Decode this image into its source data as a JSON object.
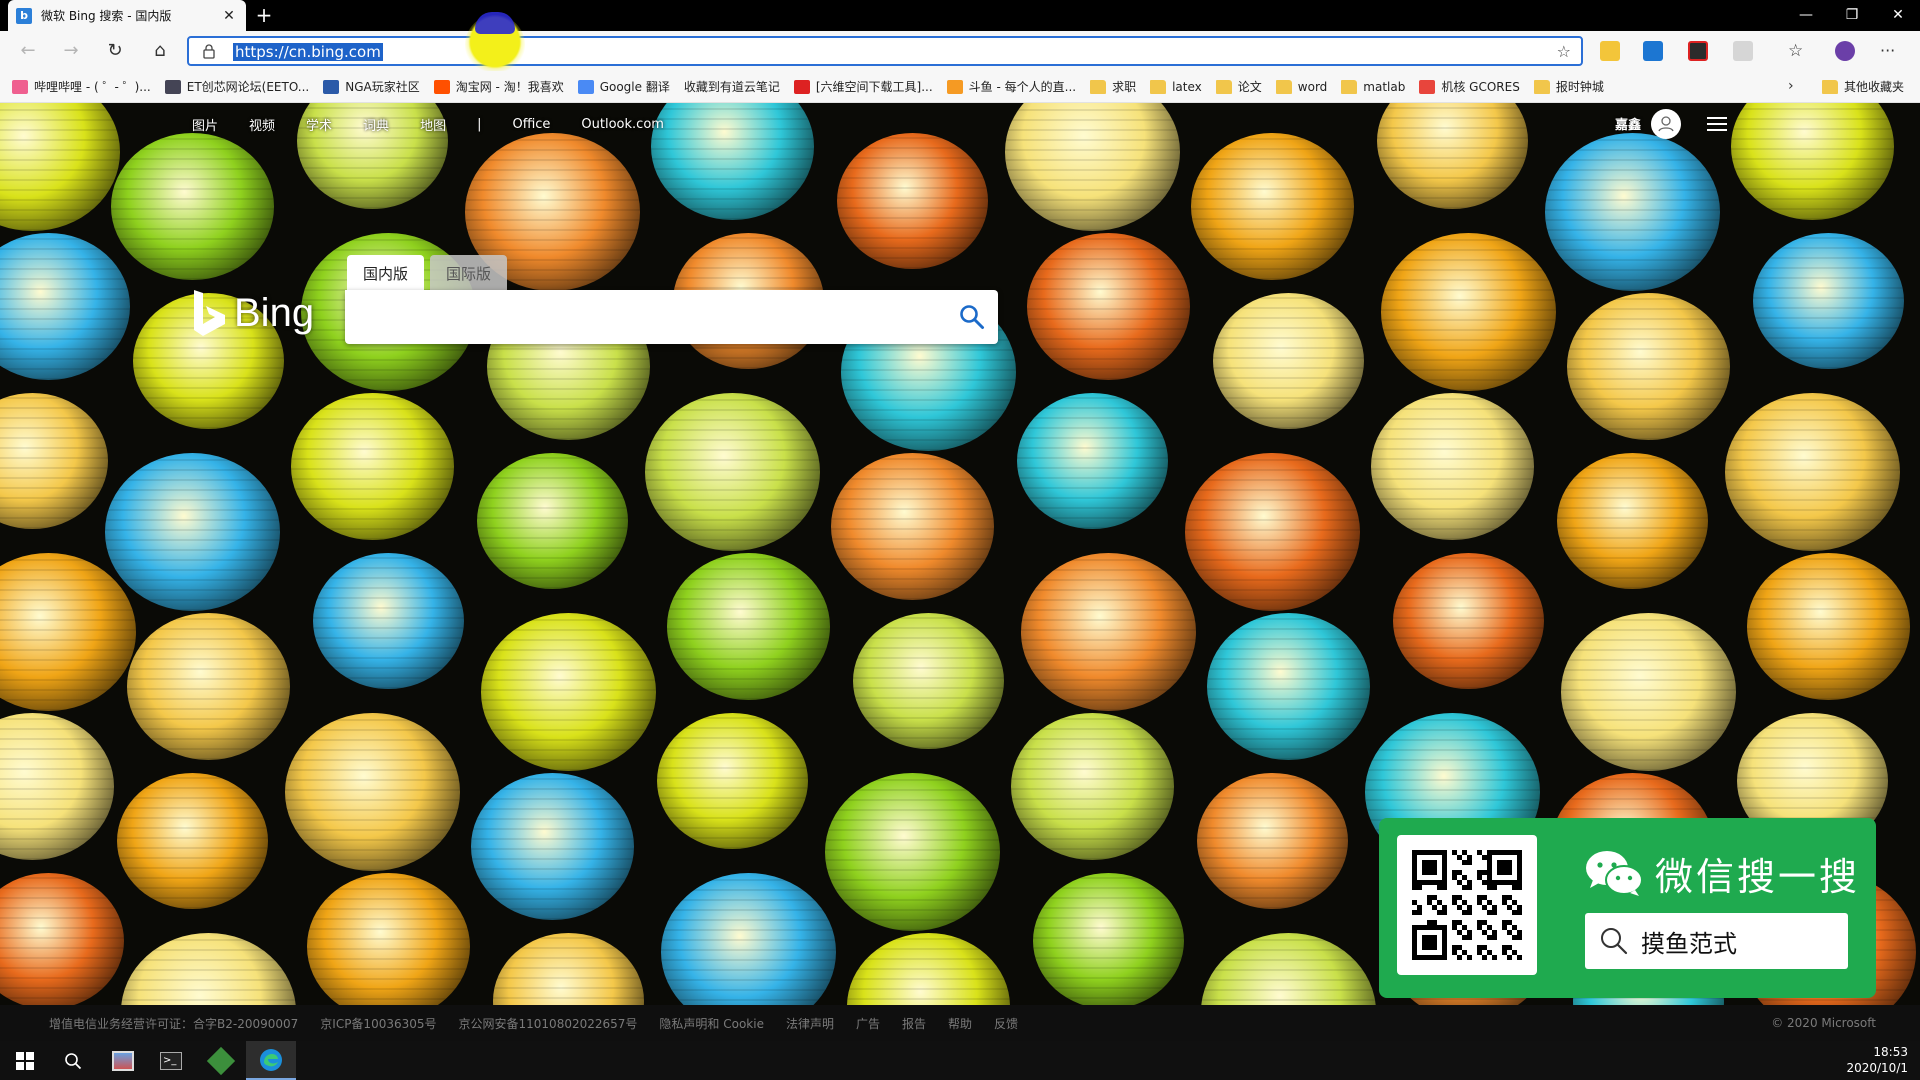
{
  "browser": {
    "tab_title": "微软 Bing 搜索 - 国内版",
    "tab_favicon": "b",
    "url": "https://cn.bing.com"
  },
  "favorites": [
    {
      "label": "哔哩哔哩 - ( ゜- ゜)...",
      "icon": "bilibili-icon",
      "color": "#ef5f8f"
    },
    {
      "label": "ET创芯网论坛(EETO...",
      "icon": "eetop-icon",
      "color": "#445"
    },
    {
      "label": "NGA玩家社区",
      "icon": "nga-icon",
      "color": "#2b5aa8"
    },
    {
      "label": "淘宝网 - 淘！我喜欢",
      "icon": "taobao-icon",
      "color": "#ff5000"
    },
    {
      "label": "Google 翻译",
      "icon": "google-translate-icon",
      "color": "#4a8af4"
    },
    {
      "label": "收藏到有道云笔记",
      "icon": "page-icon",
      "color": "#ffffff"
    },
    {
      "label": "[六维空间下载工具]...",
      "icon": "6v-icon",
      "color": "#d22"
    },
    {
      "label": "斗鱼 - 每个人的直...",
      "icon": "douyu-icon",
      "color": "#f59a23"
    },
    {
      "label": "求职",
      "icon": "folder-icon",
      "color": "#f1c64b"
    },
    {
      "label": "latex",
      "icon": "folder-icon",
      "color": "#f1c64b"
    },
    {
      "label": "论文",
      "icon": "folder-icon",
      "color": "#f1c64b"
    },
    {
      "label": "word",
      "icon": "folder-icon",
      "color": "#f1c64b"
    },
    {
      "label": "matlab",
      "icon": "folder-icon",
      "color": "#f1c64b"
    },
    {
      "label": "机核 GCORES",
      "icon": "gcores-icon",
      "color": "#e8453c"
    },
    {
      "label": "报时钟城",
      "icon": "folder-icon",
      "color": "#f1c64b"
    }
  ],
  "favorites_other": "其他收藏夹",
  "bing": {
    "nav": [
      "图片",
      "视频",
      "学术",
      "词典",
      "地图",
      "|",
      "Office",
      "Outlook.com"
    ],
    "user_name": "嘉鑫",
    "logo_text": "Bing",
    "tab_domestic": "国内版",
    "tab_international": "国际版",
    "search_value": ""
  },
  "promo": {
    "title": "微信搜一搜",
    "search_text": "摸鱼范式",
    "brand_color": "#1faa4f"
  },
  "footer": {
    "links": [
      "增值电信业务经营许可证：合字B2-20090007",
      "京ICP备10036305号",
      "京公网安备11010802022657号",
      "隐私声明和 Cookie",
      "法律声明",
      "广告",
      "报告",
      "帮助",
      "反馈"
    ],
    "copyright": "© 2020 Microsoft"
  },
  "taskbar": {
    "time": "18:53",
    "date": "2020/10/1"
  }
}
